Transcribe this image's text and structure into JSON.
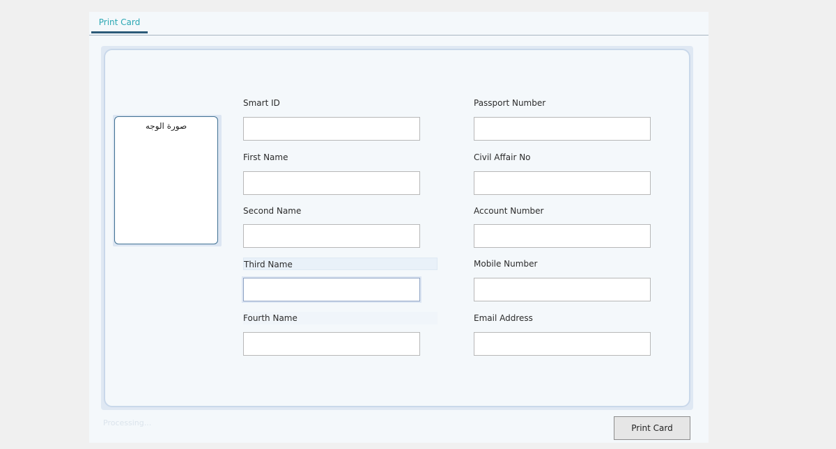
{
  "tabs": [
    {
      "label": "Print Card"
    }
  ],
  "photo": {
    "label": "صورة الوجه"
  },
  "fields": {
    "smart_id": {
      "label": "Smart ID",
      "value": ""
    },
    "first_name": {
      "label": "First Name",
      "value": ""
    },
    "second_name": {
      "label": "Second Name",
      "value": ""
    },
    "third_name": {
      "label": "Third Name",
      "value": ""
    },
    "fourth_name": {
      "label": "Fourth Name",
      "value": ""
    },
    "passport_number": {
      "label": "Passport Number",
      "value": ""
    },
    "civil_affair_no": {
      "label": "Civil Affair No",
      "value": ""
    },
    "account_number": {
      "label": "Account Number",
      "value": ""
    },
    "mobile_number": {
      "label": "Mobile Number",
      "value": ""
    },
    "email_address": {
      "label": "Email Address",
      "value": ""
    }
  },
  "status": {
    "text": "Processing..."
  },
  "actions": {
    "print_label": "Print Card"
  },
  "colors": {
    "accent": "#2aa7b3",
    "tab_underline": "#2c5a78",
    "panel_border": "#c9d8ea"
  }
}
